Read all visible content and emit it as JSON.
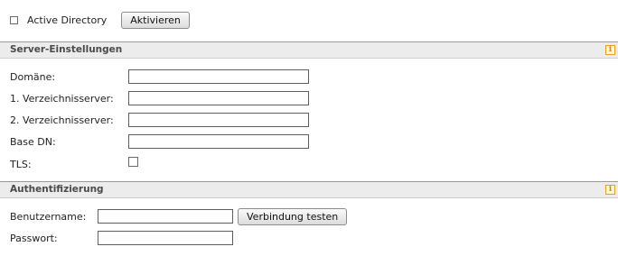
{
  "activation": {
    "checkbox_label": "Active Directory",
    "checked": false,
    "activate_button": "Aktivieren"
  },
  "server_section": {
    "title": "Server-Einstellungen",
    "info_icon": "info-icon",
    "fields": {
      "domain_label": "Domäne:",
      "domain_value": "",
      "server1_label": "1. Verzeichnisserver:",
      "server1_value": "",
      "server2_label": "2. Verzeichnisserver:",
      "server2_value": "",
      "basedn_label": "Base DN:",
      "basedn_value": "",
      "tls_label": "TLS:",
      "tls_checked": false
    }
  },
  "auth_section": {
    "title": "Authentifizierung",
    "info_icon": "info-icon",
    "fields": {
      "username_label": "Benutzername:",
      "username_value": "",
      "test_button": "Verbindung testen",
      "password_label": "Passwort:",
      "password_value": ""
    }
  },
  "colors": {
    "section_header_bg": "#ececec",
    "info_icon": "#e2a21a"
  }
}
